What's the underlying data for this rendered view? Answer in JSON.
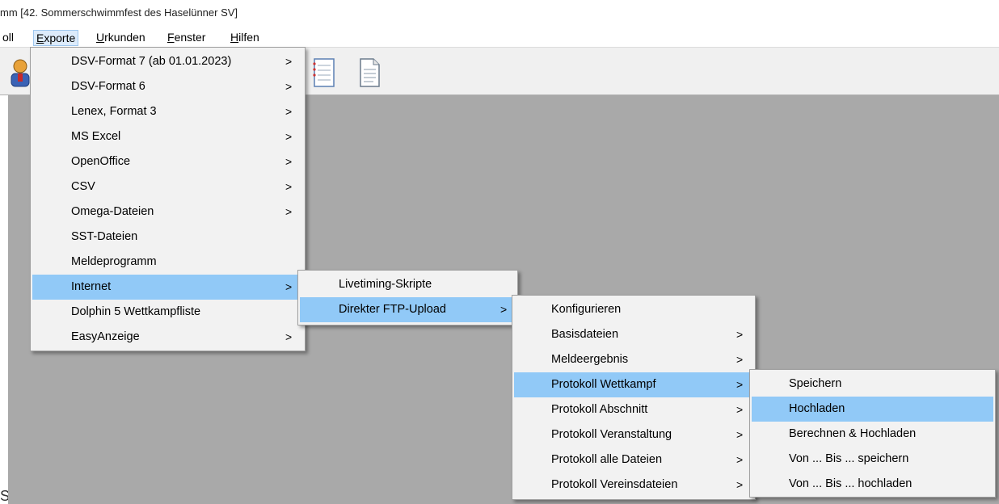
{
  "window": {
    "title": "mm [42. Sommerschwimmfest des Haselünner SV]"
  },
  "menubar": [
    {
      "prefix": "oll",
      "underline": "",
      "rest": ""
    },
    {
      "prefix": "",
      "underline": "E",
      "rest": "xporte"
    },
    {
      "prefix": "",
      "underline": "U",
      "rest": "rkunden"
    },
    {
      "prefix": "",
      "underline": "F",
      "rest": "enster"
    },
    {
      "prefix": "",
      "underline": "H",
      "rest": "ilfen"
    }
  ],
  "toolbar": {
    "icons": [
      "user-icon",
      "notepad-icon",
      "document-icon"
    ]
  },
  "workspace": {
    "edge_glyph": "S"
  },
  "menus": {
    "exporte": [
      {
        "label": "DSV-Format 7 (ab 01.01.2023)",
        "arrow": ">"
      },
      {
        "label": "DSV-Format 6",
        "arrow": ">"
      },
      {
        "label": "Lenex, Format 3",
        "arrow": ">"
      },
      {
        "label": "MS Excel",
        "arrow": ">"
      },
      {
        "label": "OpenOffice",
        "arrow": ">"
      },
      {
        "label": "CSV",
        "arrow": ">"
      },
      {
        "label": "Omega-Dateien",
        "arrow": ">"
      },
      {
        "label": "SST-Dateien",
        "arrow": ""
      },
      {
        "label": "Meldeprogramm",
        "arrow": ""
      },
      {
        "label": "Internet",
        "arrow": ">"
      },
      {
        "label": "Dolphin 5 Wettkampfliste",
        "arrow": ""
      },
      {
        "label": "EasyAnzeige",
        "arrow": ">"
      }
    ],
    "internet": [
      {
        "label": "Livetiming-Skripte",
        "arrow": ""
      },
      {
        "label": "Direkter FTP-Upload",
        "arrow": ">"
      }
    ],
    "ftp_upload": [
      {
        "label": "Konfigurieren",
        "arrow": ""
      },
      {
        "label": "Basisdateien",
        "arrow": ">"
      },
      {
        "label": "Meldeergebnis",
        "arrow": ">"
      },
      {
        "label": "Protokoll Wettkampf",
        "arrow": ">"
      },
      {
        "label": "Protokoll Abschnitt",
        "arrow": ">"
      },
      {
        "label": "Protokoll Veranstaltung",
        "arrow": ">"
      },
      {
        "label": "Protokoll alle Dateien",
        "arrow": ">"
      },
      {
        "label": "Protokoll Vereinsdateien",
        "arrow": ">"
      }
    ],
    "protokoll_wettkampf": [
      {
        "label": "Speichern"
      },
      {
        "label": "Hochladen"
      },
      {
        "label": "Berechnen & Hochladen"
      },
      {
        "label": "Von ... Bis ... speichern"
      },
      {
        "label": "Von ... Bis ... hochladen"
      }
    ]
  },
  "selection": {
    "highlight_color": "#91c9f7"
  }
}
